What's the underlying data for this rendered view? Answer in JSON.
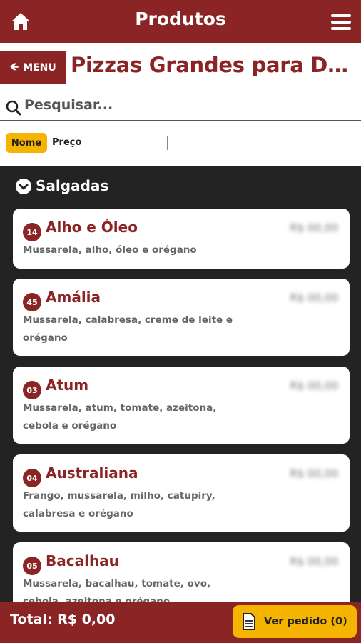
{
  "header": {
    "title": "Produtos",
    "home_icon": "home-icon",
    "menu_icon": "hamburger-icon"
  },
  "subheader": {
    "back_label": "MENU",
    "category_title": "Pizzas Grandes para Delivery"
  },
  "search": {
    "placeholder": "Pesquisar..."
  },
  "sort": {
    "active": "Nome",
    "other": "Preço"
  },
  "section": {
    "title": "Salgadas"
  },
  "products": [
    {
      "num": "14",
      "name": "Alho e Óleo",
      "price": "R$ 00,00",
      "desc": "Mussarela, alho, óleo e orégano"
    },
    {
      "num": "45",
      "name": "Amália",
      "price": "R$ 00,00",
      "desc": "Mussarela, calabresa, creme de leite e orégano"
    },
    {
      "num": "03",
      "name": "Atum",
      "price": "R$ 00,00",
      "desc": "Mussarela, atum, tomate, azeitona, cebola e orégano"
    },
    {
      "num": "04",
      "name": "Australiana",
      "price": "R$ 00,00",
      "desc": "Frango, mussarela, milho, catupiry, calabresa e orégano"
    },
    {
      "num": "05",
      "name": "Bacalhau",
      "price": "R$ 00,00",
      "desc": "Mussarela, bacalhau, tomate, ovo, cebola, azeitona e orégano"
    }
  ],
  "footer": {
    "total": "Total: R$ 0,00",
    "order_button": "Ver pedido (0)"
  },
  "colors": {
    "brand": "#8b2424",
    "accent": "#f5b400"
  }
}
